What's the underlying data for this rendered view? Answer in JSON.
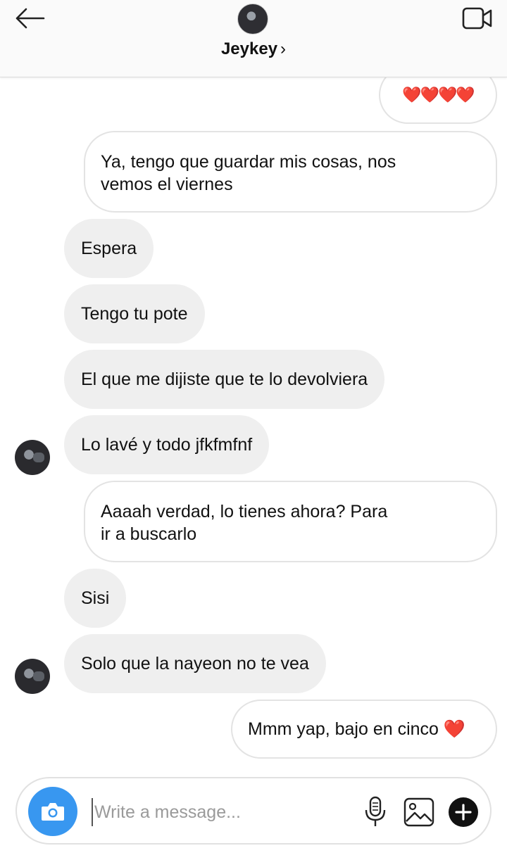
{
  "header": {
    "contact_name": "Jeykey",
    "chevron": "›",
    "icons": {
      "back": "arrow-left-icon",
      "video": "video-camera-icon"
    }
  },
  "messages": [
    {
      "side": "out",
      "text": "❤️❤️❤️❤️"
    },
    {
      "side": "out",
      "lines": [
        "Ya, tengo que guardar mis cosas, nos",
        "vemos el viernes"
      ]
    },
    {
      "side": "in",
      "text": "Espera"
    },
    {
      "side": "in",
      "text": "Tengo tu pote"
    },
    {
      "side": "in",
      "text": "El que me dijiste que te lo devolviera"
    },
    {
      "side": "in",
      "text": "Lo lavé y todo jfkfmfnf",
      "avatar": true
    },
    {
      "side": "out",
      "lines": [
        "Aaaah verdad, lo tienes ahora? Para",
        "ir a buscarlo"
      ]
    },
    {
      "side": "in",
      "text": "Sisi"
    },
    {
      "side": "in",
      "text": "Solo que la nayeon no te vea",
      "avatar": true
    },
    {
      "side": "out",
      "text": "Mmm yap, bajo en cinco ❤️"
    }
  ],
  "composer": {
    "placeholder": "Write a message...",
    "icons": {
      "camera": "camera-icon",
      "mic": "microphone-icon",
      "gallery": "image-gallery-icon",
      "add": "plus-circle-icon"
    },
    "accent_color": "#3897f0"
  },
  "colors": {
    "incoming_bubble": "#efefef",
    "outgoing_border": "#e3e3e3",
    "heart": "#e0241f"
  }
}
